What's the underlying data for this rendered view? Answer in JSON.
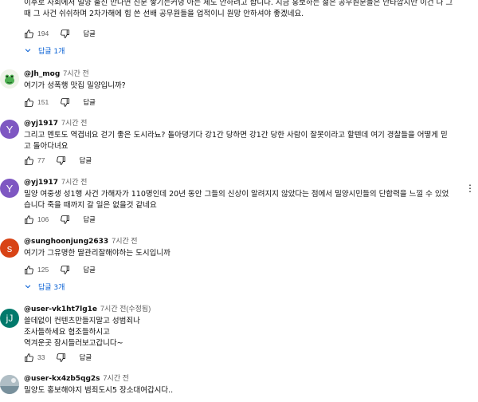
{
  "top_comment": {
    "lines": [
      "이후로 사회에서 밀양 출신 만나면 진분 쌓기는커녕 아는 체도 안하려고 합니다. 지금 홍보하는 젊은 공무원분들은 안타깝지만 이건 나 그",
      "때 그 사건 쉬쉬하며 2차가해에 힘 쓴 선배 공무원들을 업적이니 원망 안하셔야 좋겠네요."
    ],
    "likes": "194",
    "reply_label": "답글",
    "replies_toggle": "답글 1개"
  },
  "comments": [
    {
      "author": "@Jh_mog",
      "time": "7시간 전",
      "lines": [
        "여기가 성폭행 맛집 밀양입니까?"
      ],
      "likes": "151",
      "reply_label": "답글",
      "avatar": "frog-avatar"
    },
    {
      "author": "@yj1917",
      "time": "7시간 전",
      "lines": [
        "그리고 멘토도 역겹네요 걷기 좋은 도시라뇨? 돌아댕기다 강1간 당하면 강1간 당한 사람이 잘못이라고 할텐데 여기 경찰들을 어떻게 믿",
        "고 돌아다녀요"
      ],
      "likes": "77",
      "reply_label": "답글",
      "avatar_letter": "Y"
    },
    {
      "author": "@yj1917",
      "time": "7시간 전",
      "lines": [
        "밀양 여중생 성1행 사건 가해자가 110명인데 20년 동안 그들의 신상이 알려지지 않았다는 점에서 밀양시민들의 단합력을 느낄 수 있었",
        "습니다 죽을 때까지 갈 일은 없을것 같네요"
      ],
      "likes": "106",
      "reply_label": "답글",
      "avatar_letter": "Y"
    },
    {
      "author": "@sunghoonjung2633",
      "time": "7시간 전",
      "lines": [
        "여기가 그유명한 딸관리잘해야하는 도시입니까"
      ],
      "likes": "125",
      "reply_label": "답글",
      "avatar_letter": "s",
      "replies_toggle": "답글 3개"
    },
    {
      "author": "@user-vk1ht7lg1e",
      "time": "7시간 전(수정됨)",
      "lines": [
        "쓸데없이 컨텐츠만들지말고 성범죄나",
        "조사들하세요 협조들하시고",
        "역겨운곳 잠시들러보고갑니다~"
      ],
      "likes": "33",
      "reply_label": "답글",
      "avatar_letter": "jJ"
    },
    {
      "author": "@user-kx4zb5qg2s",
      "time": "7시간 전",
      "lines": [
        "밀양도 홍보해야지 범죄도시5 장소대여갑시다.."
      ],
      "avatar": "photo-avatar"
    }
  ]
}
